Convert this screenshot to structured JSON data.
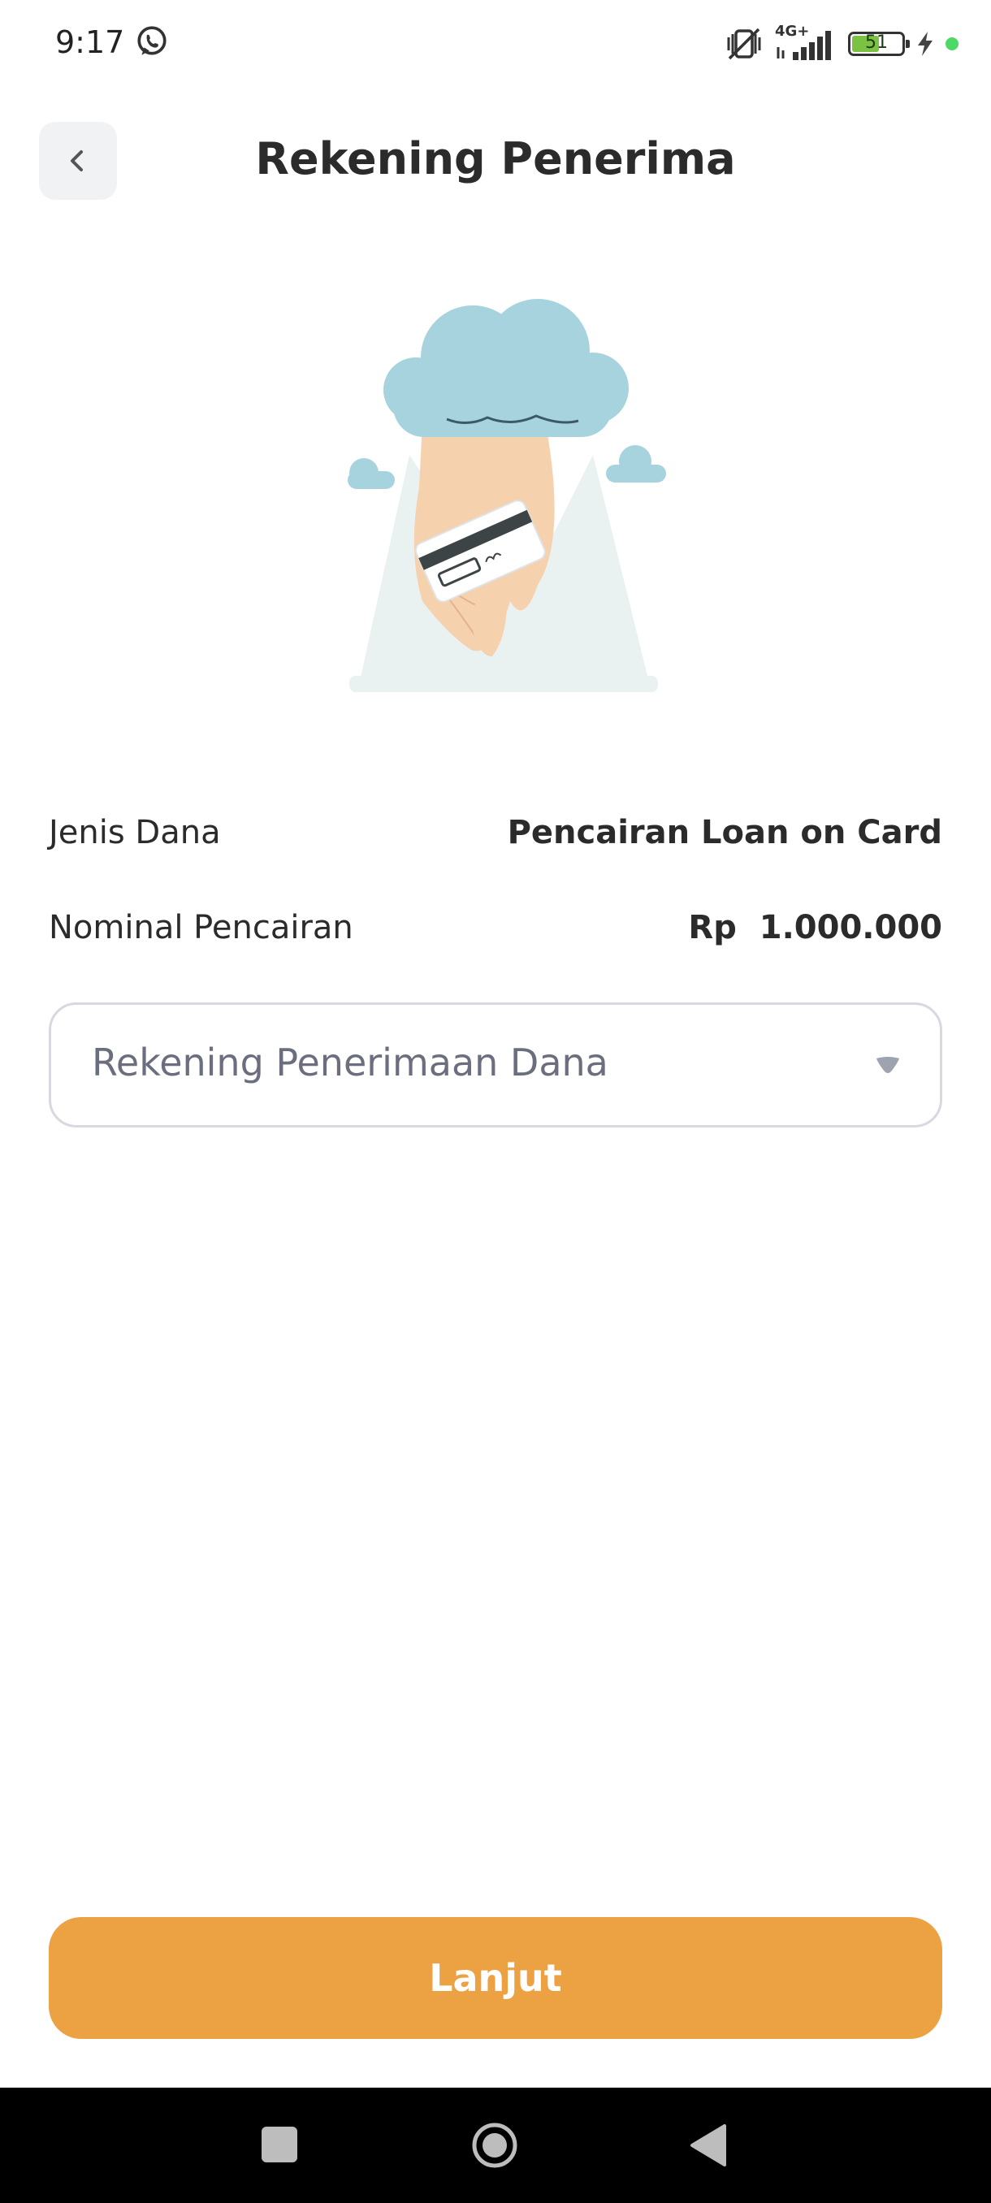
{
  "status_bar": {
    "time": "9:17",
    "whatsapp_icon": "whatsapp-icon",
    "mute_icon": "vibrate-off-icon",
    "network_label": "4G+",
    "battery_level": "51",
    "battery_level_fraction": 0.51,
    "charging": true,
    "indicator_color": "#4cd964"
  },
  "header": {
    "back_icon": "chevron-left-icon",
    "title": "Rekening Penerima"
  },
  "illustration": {
    "description_icon": "hand-holding-card-icon",
    "colors": {
      "cloud": "#a6d3de",
      "hand": "#f5d1ad",
      "mountain": "#e9f1f1",
      "card_stripe": "#3c4446"
    }
  },
  "details": {
    "fund_type_label": "Jenis Dana",
    "fund_type_value": "Pencairan Loan on Card",
    "amount_label": "Nominal Pencairan",
    "amount_currency": "Rp",
    "amount_value": "1.000.000"
  },
  "account_select": {
    "placeholder": "Rekening Penerimaan Dana",
    "caret_icon": "caret-down-icon"
  },
  "actions": {
    "continue_label": "Lanjut",
    "continue_color": "#eca243"
  },
  "nav_bar": {
    "recents_icon": "square-recents-icon",
    "home_icon": "circle-home-icon",
    "back_icon": "triangle-back-icon"
  }
}
